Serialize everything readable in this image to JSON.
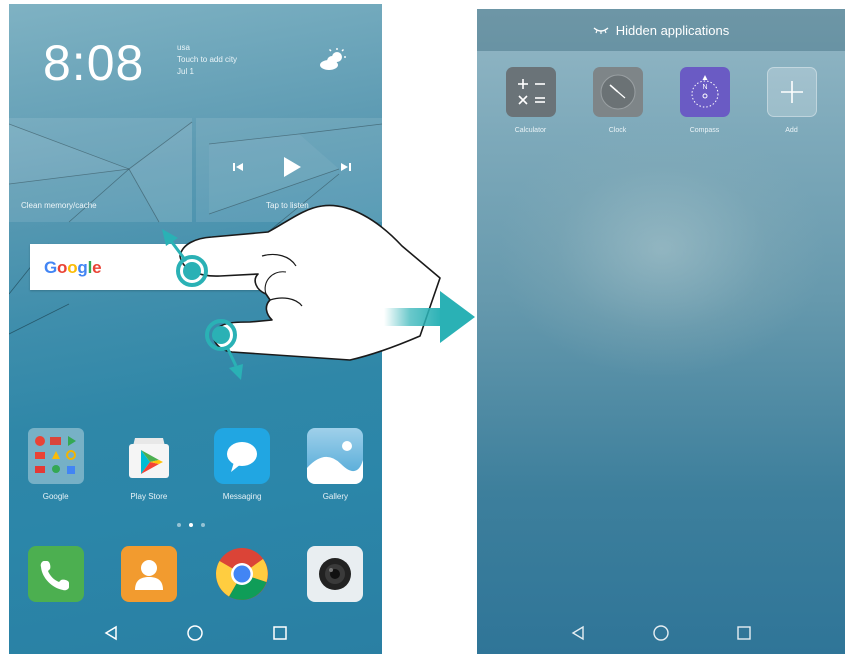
{
  "left_screen": {
    "time": "8:08",
    "date_lines": [
      "usa",
      "Touch to add city",
      "Jul 1"
    ],
    "weather_icon": "partly-cloudy-icon",
    "widget_left_label": "Clean memory/cache",
    "widget_right_label": "Tap to listen",
    "search": {
      "logo": "Google"
    },
    "apps_row1": [
      {
        "label": "Google",
        "icon": "google-folder-icon"
      },
      {
        "label": "Play Store",
        "icon": "play-store-icon"
      },
      {
        "label": "Messaging",
        "icon": "messaging-icon"
      },
      {
        "label": "Gallery",
        "icon": "gallery-icon"
      }
    ],
    "page_count": 3,
    "active_page": 2,
    "dock": [
      {
        "icon": "phone-icon"
      },
      {
        "icon": "contacts-icon"
      },
      {
        "icon": "chrome-icon"
      },
      {
        "icon": "camera-icon"
      }
    ]
  },
  "right_screen": {
    "header_title": "Hidden applications",
    "apps": [
      {
        "label": "Calculator",
        "icon": "calculator-icon"
      },
      {
        "label": "Clock",
        "icon": "clock-icon"
      },
      {
        "label": "Compass",
        "icon": "compass-icon"
      },
      {
        "label": "Add",
        "icon": "add-icon"
      }
    ]
  },
  "colors": {
    "accent_teal": "#2ab1b5",
    "phone_green": "#4caf50",
    "contacts_orange": "#f29b2f",
    "compass_purple": "#6a5bc4"
  }
}
